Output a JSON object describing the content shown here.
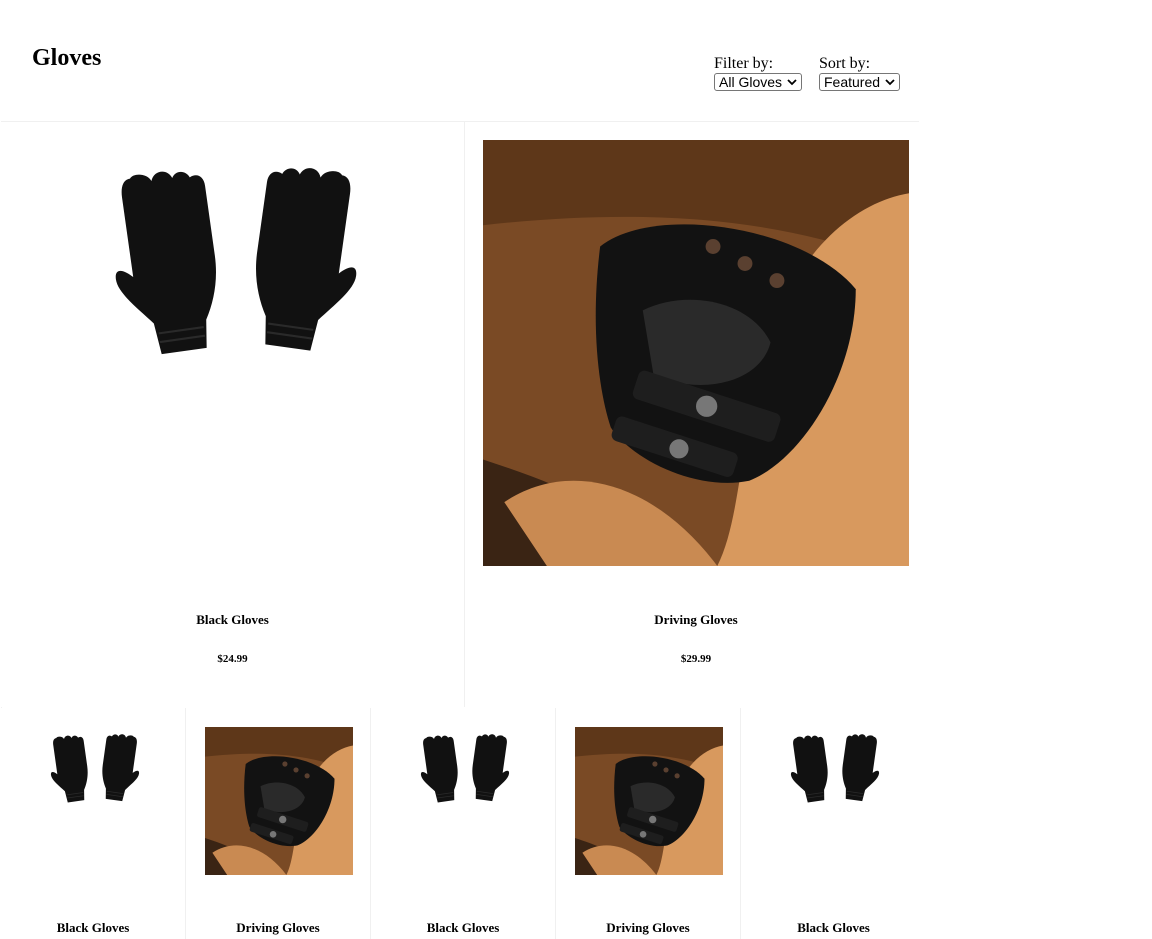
{
  "page": {
    "title": "Gloves"
  },
  "filter": {
    "label": "Filter by:",
    "selected": "All Gloves"
  },
  "sort": {
    "label": "Sort by:",
    "selected": "Featured"
  },
  "featured_products": [
    {
      "name": "Black Gloves",
      "price": "$24.99",
      "image": "black-knit-gloves"
    },
    {
      "name": "Driving Gloves",
      "price": "$29.99",
      "image": "leather-driving-gloves"
    }
  ],
  "products": [
    {
      "name": "Black Gloves",
      "image": "black-knit-gloves"
    },
    {
      "name": "Driving Gloves",
      "image": "leather-driving-gloves"
    },
    {
      "name": "Black Gloves",
      "image": "black-knit-gloves"
    },
    {
      "name": "Driving Gloves",
      "image": "leather-driving-gloves"
    },
    {
      "name": "Black Gloves",
      "image": "black-knit-gloves"
    }
  ],
  "colors": {
    "border": "#f0f0f0",
    "leather": "#c98a52",
    "glove": "#111111"
  }
}
